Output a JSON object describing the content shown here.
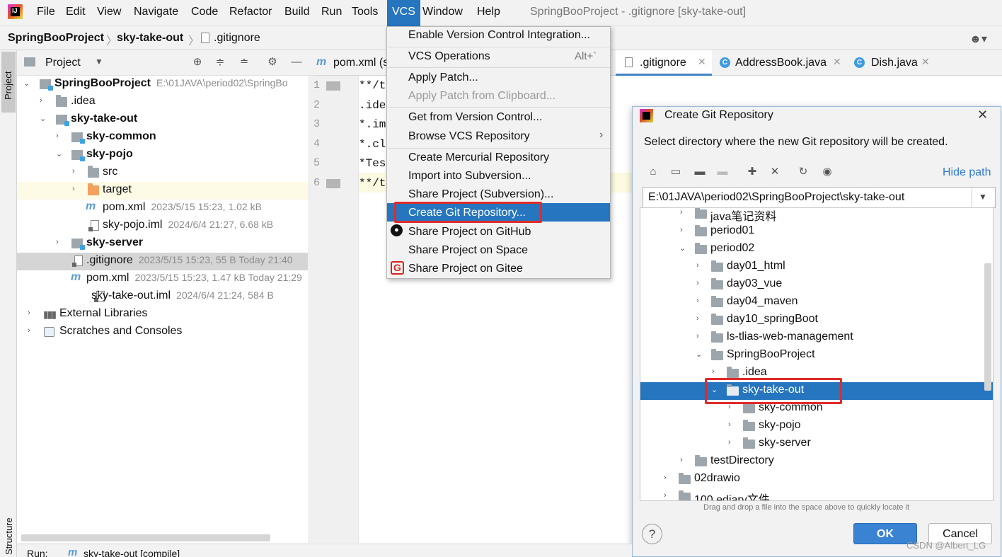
{
  "menubar": {
    "items": [
      "File",
      "Edit",
      "View",
      "Navigate",
      "Code",
      "Refactor",
      "Build",
      "Run",
      "Tools",
      "VCS",
      "Window",
      "Help"
    ],
    "active": "VCS",
    "window_title": "SpringBooProject - .gitignore [sky-take-out]"
  },
  "breadcrumb": {
    "items": [
      "SpringBooProject",
      "sky-take-out",
      ".gitignore"
    ]
  },
  "sidebar": {
    "project_tab": "Project",
    "structure_tab": "Structure"
  },
  "project_panel": {
    "title": "Project",
    "tree": [
      {
        "label": "SpringBooProject",
        "meta": "E:\\01JAVA\\period02\\SpringBo",
        "bold": true
      },
      {
        "label": ".idea",
        "meta": ""
      },
      {
        "label": "sky-take-out",
        "meta": "",
        "bold": true
      },
      {
        "label": "sky-common",
        "meta": "",
        "bold": true
      },
      {
        "label": "sky-pojo",
        "meta": "",
        "bold": true
      },
      {
        "label": "src",
        "meta": ""
      },
      {
        "label": "target",
        "meta": ""
      },
      {
        "label": "pom.xml",
        "meta": "2023/5/15 15:23, 1.02 kB"
      },
      {
        "label": "sky-pojo.iml",
        "meta": "2024/6/4 21:27, 6.68 kB"
      },
      {
        "label": "sky-server",
        "meta": "",
        "bold": true
      },
      {
        "label": ".gitignore",
        "meta": "2023/5/15 15:23, 55 B Today 21:40"
      },
      {
        "label": "pom.xml",
        "meta": "2023/5/15 15:23, 1.47 kB Today 21:29"
      },
      {
        "label": "sky-take-out.iml",
        "meta": "2024/6/4 21:24, 584 B"
      },
      {
        "label": "External Libraries",
        "meta": ""
      },
      {
        "label": "Scratches and Consoles",
        "meta": ""
      }
    ]
  },
  "editor": {
    "tabs": [
      "pom.xml (s",
      ".gitignore",
      "AddressBook.java",
      "Dish.java"
    ],
    "line_numbers": [
      "1",
      "2",
      "3",
      "4",
      "5",
      "6"
    ],
    "lines": [
      "**/t",
      ".ide",
      "*.im",
      "*.cl",
      "*Tes",
      "**/t"
    ]
  },
  "vcs_menu": {
    "items": [
      {
        "label": "Enable Version Control Integration...",
        "shortcut": ""
      },
      {
        "label": "VCS Operations",
        "shortcut": "Alt+`"
      },
      {
        "label": "Apply Patch...",
        "shortcut": ""
      },
      {
        "label": "Apply Patch from Clipboard...",
        "shortcut": ""
      },
      {
        "label": "Get from Version Control...",
        "shortcut": ""
      },
      {
        "label": "Browse VCS Repository",
        "shortcut": ""
      },
      {
        "label": "Create Mercurial Repository",
        "shortcut": ""
      },
      {
        "label": "Import into Subversion...",
        "shortcut": ""
      },
      {
        "label": "Share Project (Subversion)...",
        "shortcut": ""
      },
      {
        "label": "Create Git Repository...",
        "shortcut": ""
      },
      {
        "label": "Share Project on GitHub",
        "shortcut": ""
      },
      {
        "label": "Share Project on Space",
        "shortcut": ""
      },
      {
        "label": "Share Project on Gitee",
        "shortcut": ""
      }
    ],
    "selected": "Create Git Repository..."
  },
  "dialog": {
    "title": "Create Git Repository",
    "description": "Select directory where the new Git repository will be created.",
    "hide_path": "Hide path",
    "path_value": "E:\\01JAVA\\period02\\SpringBooProject\\sky-take-out",
    "tree": [
      {
        "label": "java笔记资料"
      },
      {
        "label": "period01"
      },
      {
        "label": "period02"
      },
      {
        "label": "day01_html"
      },
      {
        "label": "day03_vue"
      },
      {
        "label": "day04_maven"
      },
      {
        "label": "day10_springBoot"
      },
      {
        "label": "ls-tlias-web-management"
      },
      {
        "label": "SpringBooProject"
      },
      {
        "label": ".idea"
      },
      {
        "label": "sky-take-out"
      },
      {
        "label": "sky-common"
      },
      {
        "label": "sky-pojo"
      },
      {
        "label": "sky-server"
      },
      {
        "label": "testDirectory"
      },
      {
        "label": "02drawio"
      },
      {
        "label": "100 ediary文件"
      }
    ],
    "hint": "Drag and drop a file into the space above to quickly locate it",
    "ok_label": "OK",
    "cancel_label": "Cancel",
    "help_label": "?"
  },
  "bottom": {
    "run_label": "Run:",
    "run_config": "sky-take-out [compile]",
    "watermark": "CSDN @Albert_LG"
  },
  "colors": {
    "accent": "#2675bf",
    "highlight_box": "#e02b2b",
    "panel_bg": "#f2f2f2"
  }
}
